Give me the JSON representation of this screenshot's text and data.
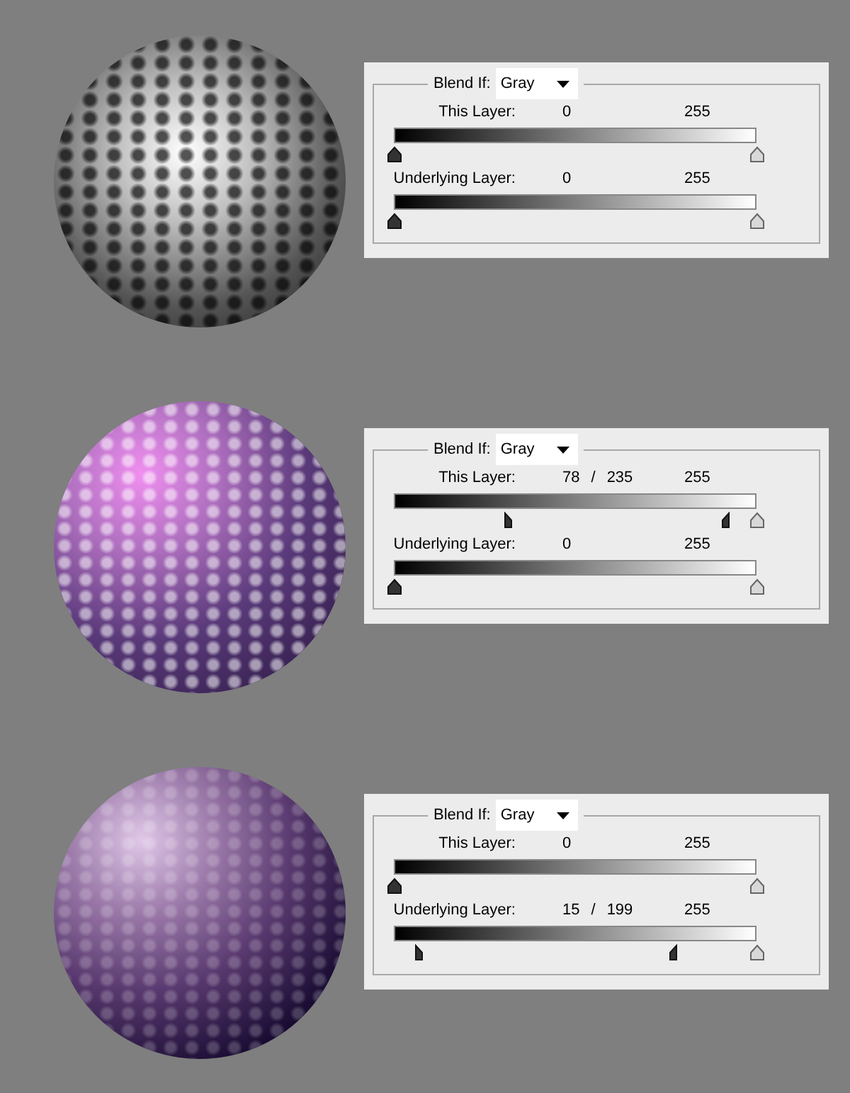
{
  "panels": [
    {
      "blend_if": {
        "label": "Blend If:",
        "value": "Gray"
      },
      "sliders": [
        {
          "label": "This Layer:",
          "low": [
            "0"
          ],
          "high": "255",
          "handles": [
            {
              "kind": "dark",
              "level": 0
            },
            {
              "kind": "light",
              "level": 1
            }
          ]
        },
        {
          "label": "Underlying Layer:",
          "low": [
            "0"
          ],
          "high": "255",
          "handles": [
            {
              "kind": "dark",
              "level": 0
            },
            {
              "kind": "light",
              "level": 1
            }
          ]
        }
      ]
    },
    {
      "blend_if": {
        "label": "Blend If:",
        "value": "Gray"
      },
      "sliders": [
        {
          "label": "This Layer:",
          "low": [
            "78",
            "/",
            "235"
          ],
          "high": "255",
          "handles": [
            {
              "kind": "dark-left-half",
              "level": 0.306
            },
            {
              "kind": "dark-right-half",
              "level": 0.922
            },
            {
              "kind": "light",
              "level": 1
            }
          ]
        },
        {
          "label": "Underlying Layer:",
          "low": [
            "0"
          ],
          "high": "255",
          "handles": [
            {
              "kind": "dark",
              "level": 0
            },
            {
              "kind": "light",
              "level": 1
            }
          ]
        }
      ]
    },
    {
      "blend_if": {
        "label": "Blend If:",
        "value": "Gray"
      },
      "sliders": [
        {
          "label": "This Layer:",
          "low": [
            "0"
          ],
          "high": "255",
          "handles": [
            {
              "kind": "dark",
              "level": 0
            },
            {
              "kind": "light",
              "level": 1
            }
          ]
        },
        {
          "label": "Underlying Layer:",
          "low": [
            "15",
            "/",
            "199"
          ],
          "high": "255",
          "handles": [
            {
              "kind": "dark-left-half",
              "level": 0.059
            },
            {
              "kind": "dark-right-half",
              "level": 0.78
            },
            {
              "kind": "light",
              "level": 1
            }
          ]
        }
      ]
    }
  ]
}
